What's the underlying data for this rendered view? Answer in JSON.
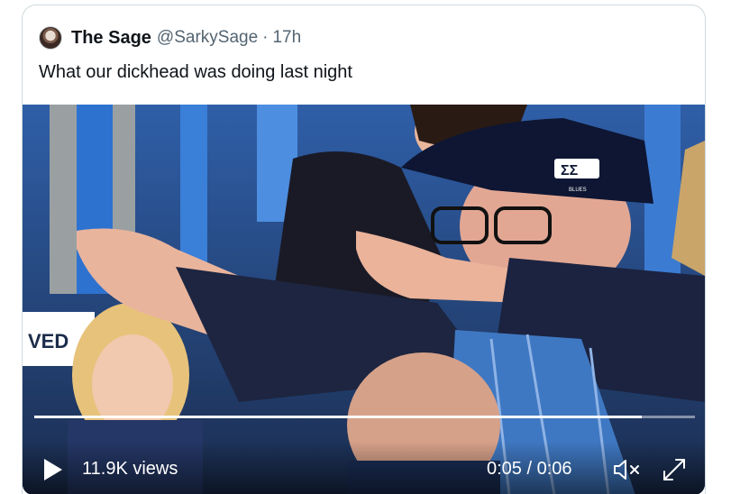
{
  "tweet": {
    "author_name": "The Sage",
    "handle": "@SarkySage",
    "separator": "·",
    "timestamp": "17h",
    "text": "What our dickhead was doing last night",
    "avatar_icon": "profile-avatar"
  },
  "video": {
    "views": "11.9K views",
    "time_display": "0:05 / 0:06",
    "progress": 0.92,
    "muted": true,
    "play_icon": "play-icon",
    "mute_icon": "volume-muted-icon",
    "fullscreen_icon": "fullscreen-icon",
    "scene_text": "VED",
    "cap_logo": "ΣΣ",
    "cap_text": "BLUES"
  },
  "colors": {
    "border": "#cfd9de",
    "secondary_text": "#536471",
    "primary_text": "#0f1419",
    "control_text": "#ffffff"
  }
}
